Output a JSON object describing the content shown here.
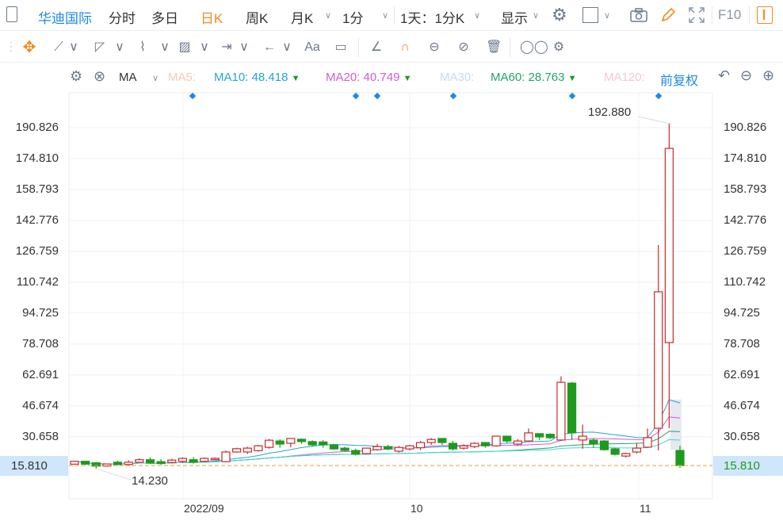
{
  "toolbar": {
    "layout_icon": "panel-icon",
    "stock_name": "华迪国际",
    "periods": [
      "分时",
      "多日",
      "日K",
      "周K",
      "月K"
    ],
    "active_period": "日K",
    "minute_select": "1分",
    "range_select": "1天：1分K",
    "display_label": "显示",
    "f10_label": "F10",
    "icons": [
      "gear-icon",
      "window-icon",
      "camera-icon",
      "pencil-icon",
      "fullscreen-icon",
      "sidebar-toggle-icon"
    ]
  },
  "drawing_tools": [
    "move-icon",
    "line-icon",
    "polygon-icon",
    "wave-icon",
    "fib-icon",
    "range-icon",
    "arrow-icon",
    "text-icon",
    "comment-icon",
    "angle-icon",
    "magnet-icon",
    "lock-visibility-icon",
    "hide-icon",
    "trash-icon",
    "compare-icon",
    "settings-icon"
  ],
  "drawing_text_tool": "Aa",
  "indicator_bar": {
    "indicator": "MA",
    "ma5": {
      "label": "MA5:",
      "value": "",
      "color": "#f7c9b8"
    },
    "ma10": {
      "label": "MA10:",
      "value": "48.418",
      "color": "#27a3d8"
    },
    "ma20": {
      "label": "MA20:",
      "value": "40.749",
      "color": "#d35bd6"
    },
    "ma30": {
      "label": "MA30:",
      "value": "",
      "color": "#c6d9f3"
    },
    "ma60": {
      "label": "MA60:",
      "value": "28.763",
      "color": "#23a46b"
    },
    "ma120": {
      "label": "MA120:",
      "value": "",
      "color": "#f7c6d0"
    },
    "adjust": "前复权"
  },
  "colors": {
    "up": "#cc2a2a",
    "down": "#1e9a1e",
    "accent": "#1e88e5",
    "active": "#f5871f",
    "current_line": "#e0a040"
  },
  "chart_data": {
    "type": "candlestick",
    "ylim": [
      8.0,
      226.0
    ],
    "y_ticks": [
      "190.826",
      "174.810",
      "158.793",
      "142.776",
      "126.759",
      "110.742",
      "94.725",
      "78.708",
      "62.691",
      "46.674",
      "30.658"
    ],
    "current_price": "15.810",
    "max_label": "192.880",
    "min_label": "14.230",
    "x_ticks": [
      "2022/09",
      "10",
      "11"
    ],
    "grid": true,
    "ohlc": [
      [
        16.5,
        18.3,
        16.3,
        18.0
      ],
      [
        18.0,
        18.2,
        16.2,
        16.5
      ],
      [
        17.2,
        17.5,
        14.23,
        15.5
      ],
      [
        15.5,
        16.8,
        15.3,
        16.6
      ],
      [
        17.5,
        18.3,
        16.0,
        16.3
      ],
      [
        16.3,
        18.5,
        16.0,
        17.5
      ],
      [
        17.5,
        19.5,
        17.2,
        18.8
      ],
      [
        18.8,
        20.0,
        16.5,
        17.0
      ],
      [
        17.8,
        19.0,
        16.3,
        16.8
      ],
      [
        17.4,
        19.3,
        17.0,
        18.6
      ],
      [
        18.0,
        20.0,
        17.2,
        19.5
      ],
      [
        18.8,
        20.2,
        16.8,
        17.5
      ],
      [
        18.0,
        20.0,
        17.5,
        19.5
      ],
      [
        18.8,
        20.0,
        18.5,
        19.5
      ],
      [
        17.8,
        23.5,
        17.5,
        22.8
      ],
      [
        22.8,
        25.0,
        22.5,
        24.5
      ],
      [
        22.8,
        25.5,
        21.8,
        24.8
      ],
      [
        23.5,
        26.5,
        23.0,
        26.0
      ],
      [
        25.2,
        29.5,
        24.5,
        28.9
      ],
      [
        28.5,
        29.5,
        25.0,
        26.9
      ],
      [
        27.3,
        30.0,
        25.2,
        29.8
      ],
      [
        29.4,
        29.8,
        27.0,
        28.2
      ],
      [
        28.2,
        28.8,
        25.5,
        26.5
      ],
      [
        28.0,
        29.0,
        25.0,
        26.5
      ],
      [
        26.5,
        27.0,
        24.0,
        24.4
      ],
      [
        24.8,
        25.5,
        23.0,
        23.6
      ],
      [
        23.6,
        24.5,
        21.0,
        21.6
      ],
      [
        22.0,
        25.0,
        21.8,
        24.8
      ],
      [
        24.0,
        27.0,
        23.5,
        25.6
      ],
      [
        25.6,
        26.5,
        23.8,
        24.4
      ],
      [
        23.2,
        26.0,
        22.5,
        25.2
      ],
      [
        24.4,
        26.5,
        23.5,
        26.0
      ],
      [
        25.0,
        28.5,
        23.8,
        27.7
      ],
      [
        27.7,
        30.0,
        26.5,
        29.3
      ],
      [
        29.8,
        30.0,
        26.5,
        27.7
      ],
      [
        27.3,
        28.5,
        23.5,
        24.4
      ],
      [
        24.8,
        26.8,
        24.0,
        26.0
      ],
      [
        25.6,
        27.8,
        24.8,
        27.3
      ],
      [
        27.7,
        28.0,
        25.0,
        26.0
      ],
      [
        26.0,
        31.2,
        25.5,
        31.0
      ],
      [
        31.0,
        31.0,
        27.5,
        28.5
      ],
      [
        26.9,
        29.5,
        26.0,
        28.5
      ],
      [
        28.5,
        35.0,
        28.0,
        32.7
      ],
      [
        32.3,
        32.5,
        29.0,
        30.6
      ],
      [
        32.0,
        32.5,
        29.5,
        30.2
      ],
      [
        29.0,
        62.0,
        28.5,
        58.9
      ],
      [
        58.5,
        59.0,
        29.0,
        32.7
      ],
      [
        29.0,
        37.0,
        24.5,
        31.0
      ],
      [
        28.9,
        30.0,
        25.0,
        26.9
      ],
      [
        28.5,
        29.0,
        23.5,
        24.0
      ],
      [
        24.4,
        25.0,
        21.0,
        21.6
      ],
      [
        20.7,
        22.5,
        20.0,
        22.0
      ],
      [
        22.8,
        27.5,
        22.0,
        24.8
      ],
      [
        25.3,
        35.0,
        25.0,
        30.2
      ],
      [
        35.1,
        130.0,
        23.6,
        105.8
      ],
      [
        79.5,
        192.88,
        35.1,
        180.1
      ],
      [
        23.6,
        26.1,
        14.6,
        15.81
      ]
    ]
  }
}
